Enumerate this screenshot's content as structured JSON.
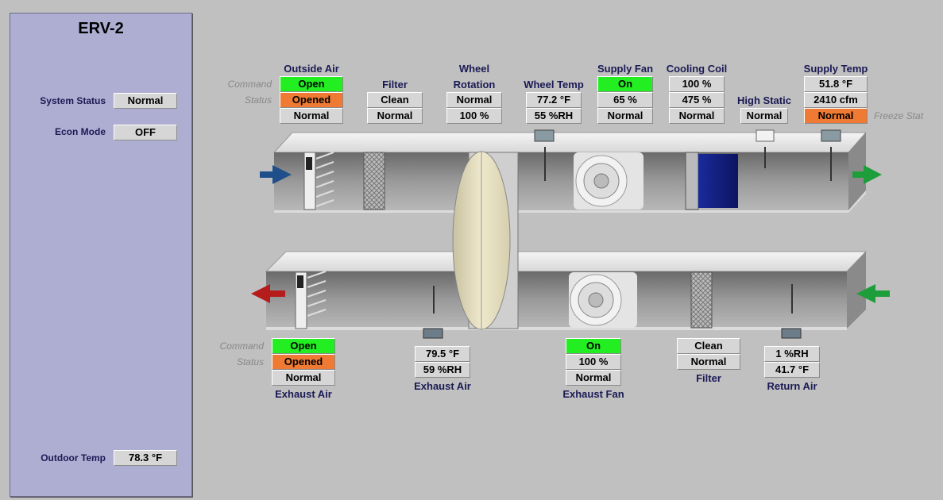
{
  "panel": {
    "title": "ERV-2",
    "system_status": {
      "label": "System Status",
      "value": "Normal"
    },
    "econ_mode": {
      "label": "Econ Mode",
      "value": "OFF"
    },
    "outdoor_temp": {
      "label": "Outdoor Temp",
      "value": "78.3 °F"
    }
  },
  "row_labels": {
    "command": "Command",
    "status": "Status",
    "freeze_stat": "Freeze Stat"
  },
  "supply": {
    "outside_air": {
      "title": "Outside Air",
      "command": "Open",
      "status": "Opened",
      "alarm": "Normal"
    },
    "filter": {
      "title": "Filter",
      "status": "Clean",
      "alarm": "Normal"
    },
    "wheel": {
      "title1": "Wheel",
      "title2": "Rotation",
      "status": "Normal",
      "speed": "100 %"
    },
    "wheel_temp": {
      "title": "Wheel Temp",
      "temp": "77.2 °F",
      "humidity": "55 %RH"
    },
    "supply_fan": {
      "title": "Supply Fan",
      "command": "On",
      "speed": "65 %",
      "alarm": "Normal"
    },
    "cooling_coil": {
      "title": "Cooling Coil",
      "valve": "100 %",
      "flow": "475 %",
      "alarm": "Normal"
    },
    "high_static": {
      "title": "High Static",
      "status": "Normal"
    },
    "supply_temp": {
      "title": "Supply Temp",
      "temp": "51.8 °F",
      "cfm": "2410 cfm",
      "freeze": "Normal"
    }
  },
  "exhaust": {
    "exhaust_air_damper": {
      "command": "Open",
      "status": "Opened",
      "alarm": "Normal",
      "title": "Exhaust Air"
    },
    "exhaust_air_sensor": {
      "temp": "79.5 °F",
      "humidity": "59 %RH",
      "title": "Exhaust Air"
    },
    "exhaust_fan": {
      "command": "On",
      "speed": "100 %",
      "alarm": "Normal",
      "title": "Exhaust Fan"
    },
    "filter": {
      "status": "Clean",
      "alarm": "Normal",
      "title": "Filter"
    },
    "return_air": {
      "humidity": "1 %RH",
      "temp": "41.7 °F",
      "title": "Return Air"
    }
  },
  "colors": {
    "panel": "#aeaed2",
    "on_green": "#22ee22",
    "alarm_orange": "#ee7a33",
    "outside_air_arrow": "#1f4f8a",
    "supply_arrow": "#1e9e3a",
    "exhaust_arrow": "#b51c1c",
    "return_arrow": "#1e9e3a"
  },
  "icons": [
    "fan-icon",
    "damper-icon",
    "filter-icon",
    "energy-wheel-icon",
    "cooling-coil-icon",
    "sensor-icon",
    "arrow-icon"
  ]
}
